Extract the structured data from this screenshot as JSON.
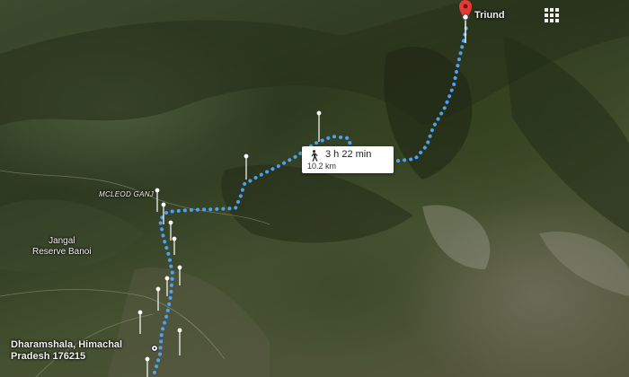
{
  "map": {
    "view": "satellite-3d",
    "route_color": "#4da6ff",
    "pin_color": "#e53935"
  },
  "places": {
    "destination": "Triund",
    "origin_line1": "Dharamshala, Himachal",
    "origin_line2": "Pradesh 176215",
    "mcleod": "MCLEOD GANJ",
    "jangal_line1": "Jangal",
    "jangal_line2": "Reserve Banoi"
  },
  "route": {
    "mode_icon": "walking-icon",
    "duration": "3 h 22 min",
    "distance": "10.2 km"
  },
  "controls": {
    "apps_icon": "grid-icon"
  }
}
